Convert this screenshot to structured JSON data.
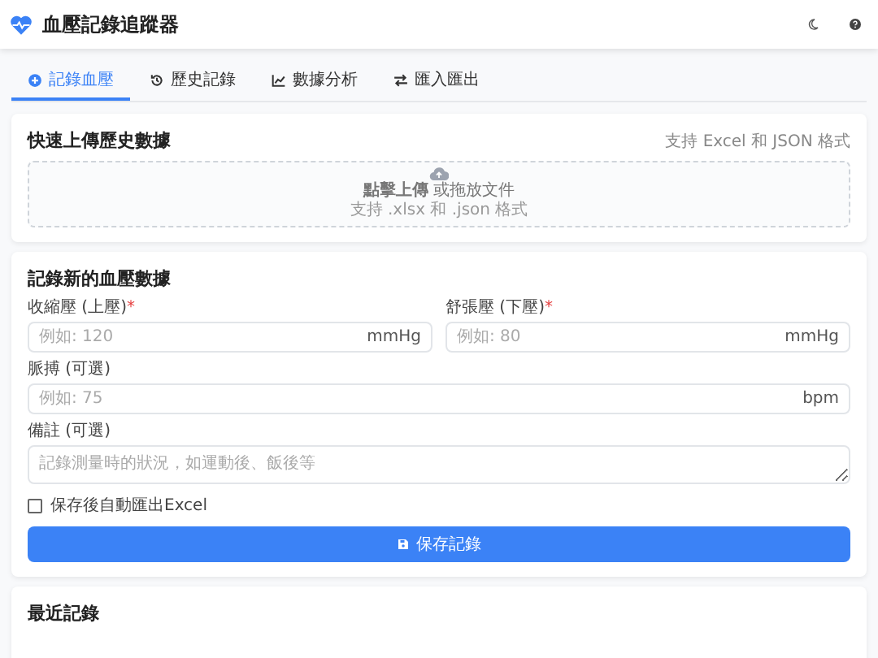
{
  "header": {
    "title": "血壓記錄追蹤器"
  },
  "tabs": [
    {
      "label": "記錄血壓",
      "selected": true
    },
    {
      "label": "歷史記錄",
      "selected": false
    },
    {
      "label": "數據分析",
      "selected": false
    },
    {
      "label": "匯入匯出",
      "selected": false
    }
  ],
  "upload": {
    "title": "快速上傳歷史數據",
    "hint": "支持 Excel 和 JSON 格式",
    "cta": "**點擊上傳** 或拖放文件",
    "formats": "支持 .xlsx 和 .json 格式"
  },
  "form": {
    "title": "記錄新的血壓數據",
    "rows": [
      [
        {
          "kind": "input",
          "label": "收縮壓 (上壓)",
          "required_mark": "*",
          "placeholder": "例如: 120",
          "unit": "mmHg"
        },
        {
          "kind": "input",
          "label": "舒張壓 (下壓)",
          "required_mark": "*",
          "placeholder": "例如: 80",
          "unit": "mmHg"
        }
      ],
      [
        {
          "kind": "input",
          "label": "脈搏 (可選)",
          "placeholder": "例如: 75",
          "unit": "bpm"
        }
      ],
      [
        {
          "kind": "textarea",
          "label": "備註 (可選)",
          "placeholder": "記錄測量時的狀況，如運動後、飯後等"
        }
      ]
    ],
    "checkbox": {
      "label": "保存後自動匯出Excel",
      "checked": false
    },
    "button": "保存記錄"
  },
  "recent": {
    "title": "最近記錄"
  }
}
